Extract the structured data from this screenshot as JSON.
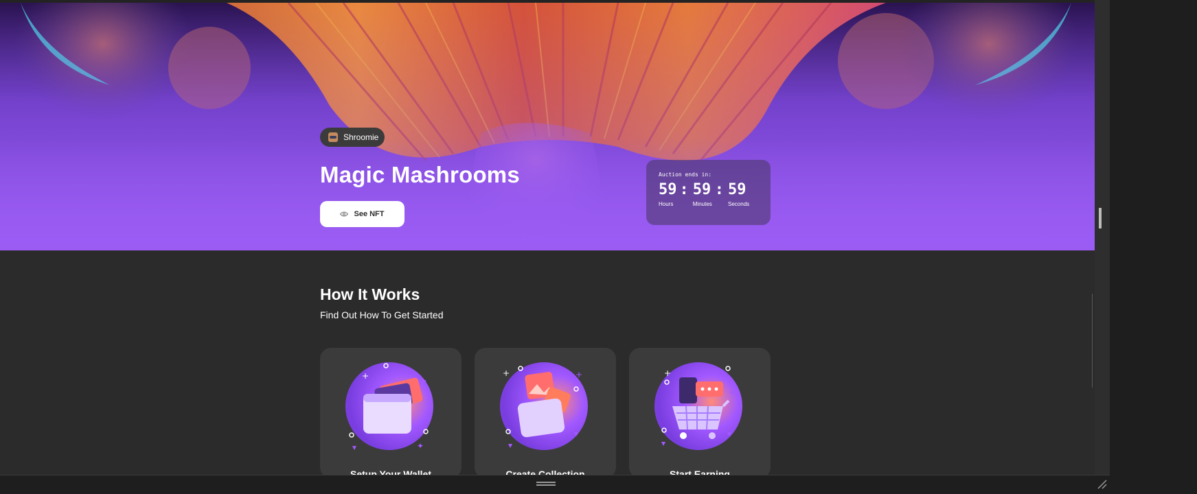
{
  "hero": {
    "artist": {
      "name": "Shroomie",
      "avatar_icon": "robot-avatar-icon"
    },
    "title": "Magic Mashrooms",
    "button": {
      "label": "See NFT",
      "icon": "eye-icon"
    },
    "auction": {
      "label": "Auction ends in:",
      "hours": "59",
      "minutes": "59",
      "seconds": "59",
      "hours_label": "Hours",
      "minutes_label": "Minutes",
      "seconds_label": "Seconds",
      "separator": ":"
    }
  },
  "how_it_works": {
    "title": "How It Works",
    "subtitle": "Find Out How To Get Started",
    "cards": [
      {
        "title": "Setup Your Wallet",
        "icon": "wallet-icon"
      },
      {
        "title": "Create Collection",
        "icon": "collection-folder-icon"
      },
      {
        "title": "Start Earning",
        "icon": "shopping-cart-icon"
      }
    ]
  },
  "colors": {
    "background": "#2b2b2b",
    "card": "#3b3b3b",
    "accent": "#a259ff",
    "white": "#ffffff"
  }
}
